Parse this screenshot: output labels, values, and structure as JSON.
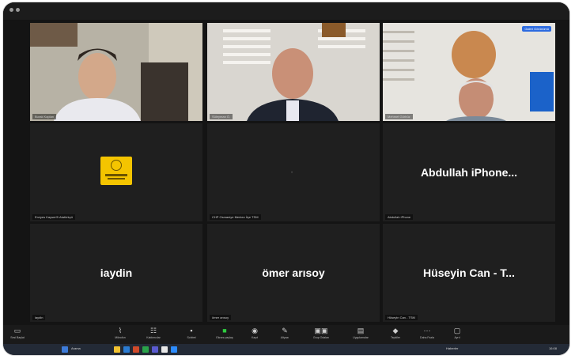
{
  "window": {
    "controls": [
      "close",
      "minimize"
    ]
  },
  "topbar": {
    "view_button": "Galeri Görünümü"
  },
  "participants": [
    {
      "label": "Burak Kaplan",
      "type": "video",
      "active": false
    },
    {
      "label": "Süleyman Ö.",
      "type": "video",
      "active": true
    },
    {
      "label": "Mehmet Gürbüz",
      "type": "video",
      "active": false
    },
    {
      "label": "Erciyes Kayseri'li Atatürkçü",
      "type": "logo",
      "active": false
    },
    {
      "label": "CHP Osmaniye Merkez İlçe TSM",
      "type": "blank",
      "active": false
    },
    {
      "label": "Abdullah iPhone",
      "display_name": "Abdullah iPhone...",
      "type": "name",
      "active": false
    },
    {
      "label": "iaydin",
      "display_name": "iaydin",
      "type": "name",
      "active": false
    },
    {
      "label": "ömer arısoy",
      "display_name": "ömer arısoy",
      "type": "name",
      "active": false
    },
    {
      "label": "Hüseyin Can - TSM",
      "display_name": "Hüseyin Can - T...",
      "type": "name",
      "active": false
    }
  ],
  "toolbar": [
    {
      "label": "Sesi Başlat",
      "icon": "camera-icon"
    },
    {
      "label": "Mikrofon",
      "icon": "mic-icon"
    },
    {
      "label": "Katılımcılar",
      "icon": "participants-icon"
    },
    {
      "label": "Sohbet",
      "icon": "chat-icon"
    },
    {
      "label": "Ekranı paylaş",
      "icon": "share-screen-icon"
    },
    {
      "label": "Kayıt",
      "icon": "record-icon"
    },
    {
      "label": "Altyazı",
      "icon": "captions-icon"
    },
    {
      "label": "Grup Odaları",
      "icon": "breakout-icon"
    },
    {
      "label": "Uygulamalar",
      "icon": "apps-icon"
    },
    {
      "label": "Tepkiler",
      "icon": "reactions-icon"
    },
    {
      "label": "Daha Fazla",
      "icon": "more-icon"
    },
    {
      "label": "Ayrıl",
      "icon": "leave-icon"
    }
  ],
  "taskbar": {
    "search": "Arama",
    "weather": "Haberler",
    "time": "16:08"
  },
  "colors": {
    "background": "#141414",
    "tile": "#1f1f1f",
    "active_outline": "#c9d06a",
    "share_green": "#2ecc40",
    "logo_yellow": "#f4c400"
  }
}
